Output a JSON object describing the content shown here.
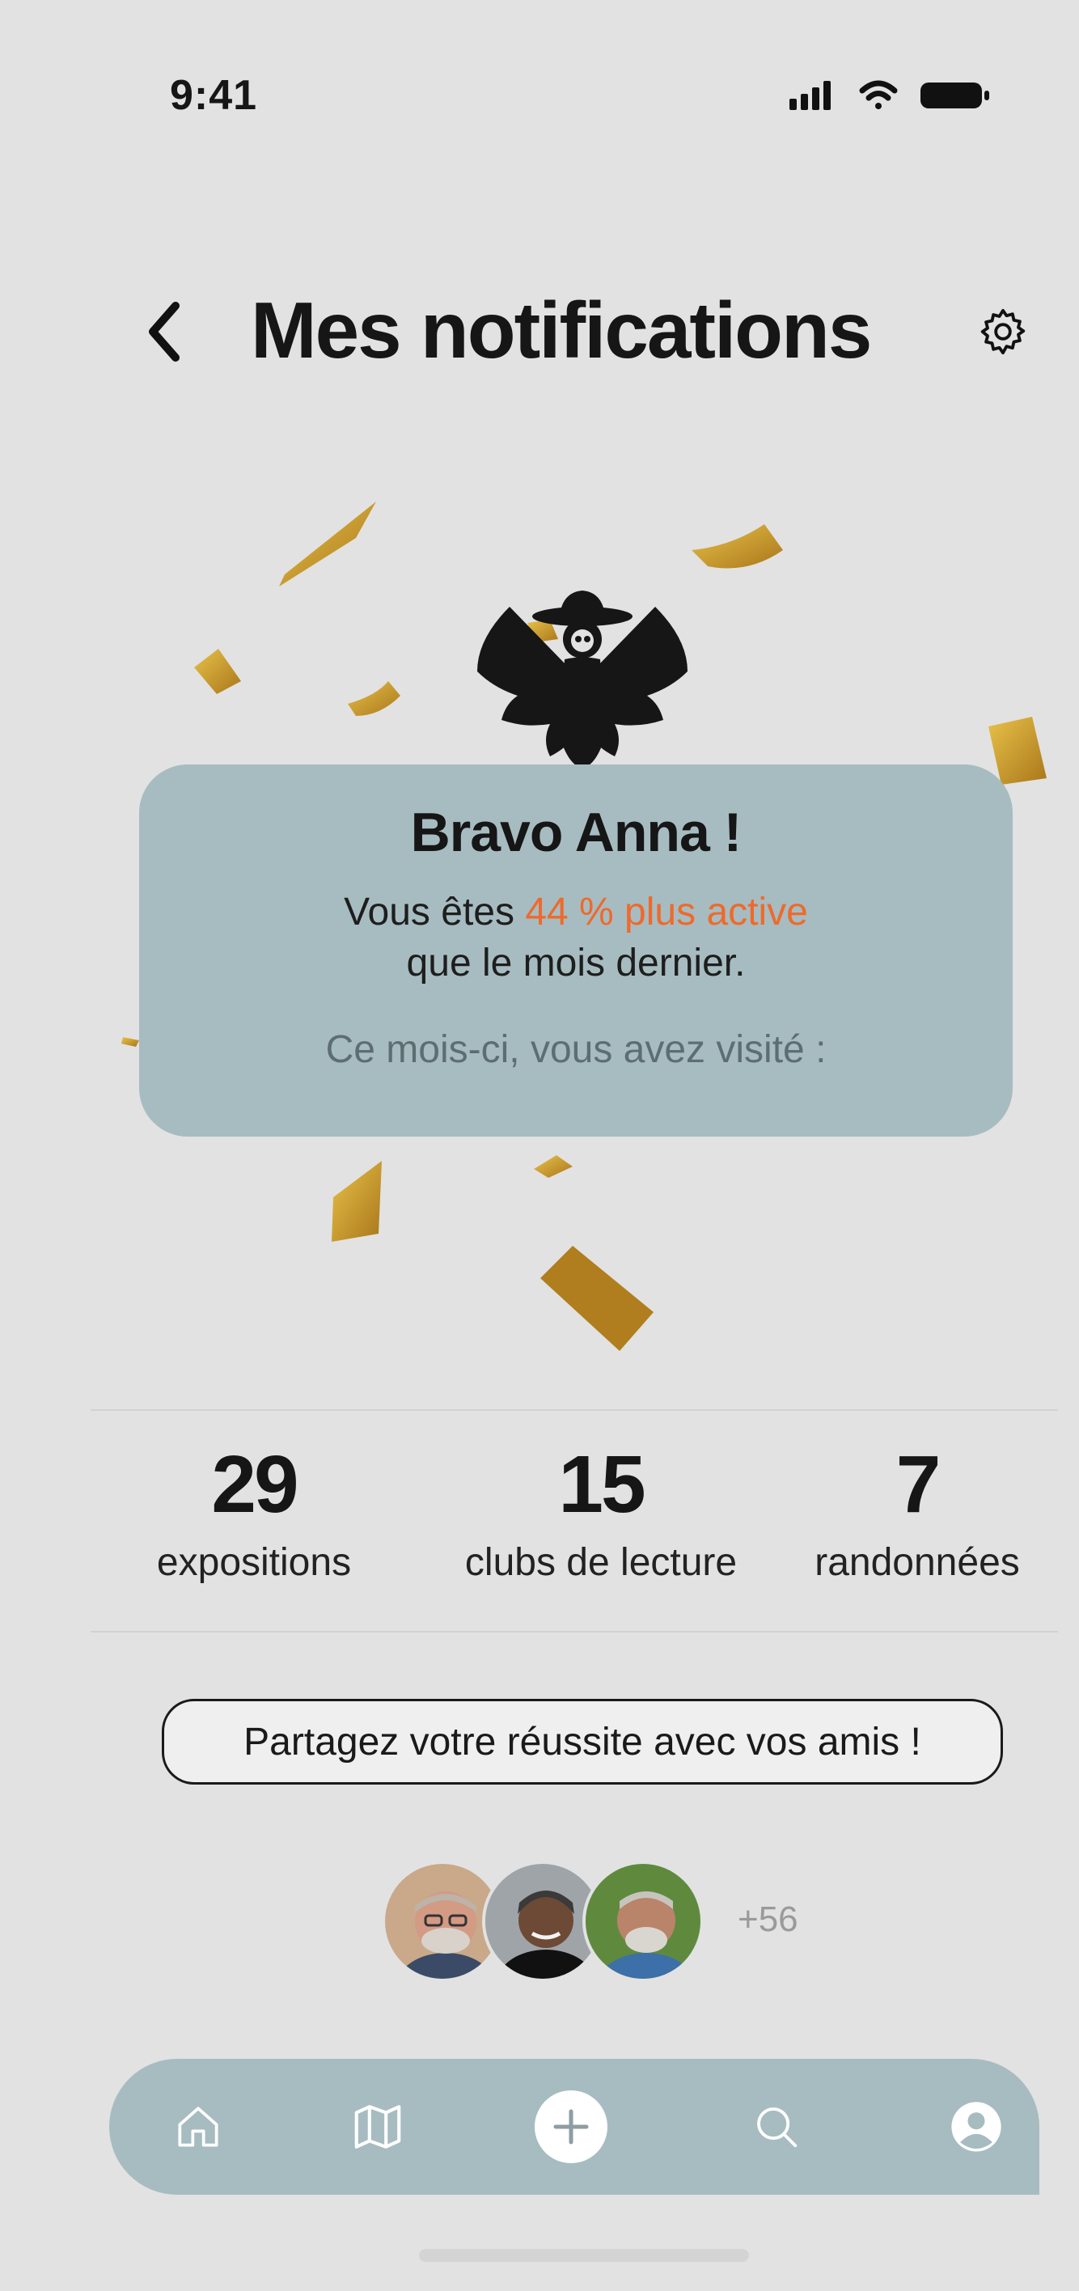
{
  "status_bar": {
    "time": "9:41"
  },
  "header": {
    "title": "Mes notifications"
  },
  "card": {
    "title": "Bravo Anna !",
    "line1_prefix": "Vous êtes ",
    "line1_highlight": "44 % plus active",
    "line2": "que le mois dernier.",
    "line3": "Ce mois-ci, vous avez visité :"
  },
  "stats": [
    {
      "value": "29",
      "label": "expositions"
    },
    {
      "value": "15",
      "label": "clubs de lecture"
    },
    {
      "value": "7",
      "label": "randonnées"
    }
  ],
  "share_button": {
    "label": "Partagez votre réussite avec vos amis !"
  },
  "friends": {
    "more_count": "+56"
  },
  "nav": {
    "items": [
      {
        "icon": "home-icon"
      },
      {
        "icon": "map-icon"
      },
      {
        "icon": "plus-icon"
      },
      {
        "icon": "search-icon"
      },
      {
        "icon": "profile-icon"
      }
    ]
  },
  "colors": {
    "background": "#e2e2e2",
    "card": "#a7bcc1",
    "highlight": "#ee6a2c",
    "confetti_gold": "#c9961e"
  }
}
